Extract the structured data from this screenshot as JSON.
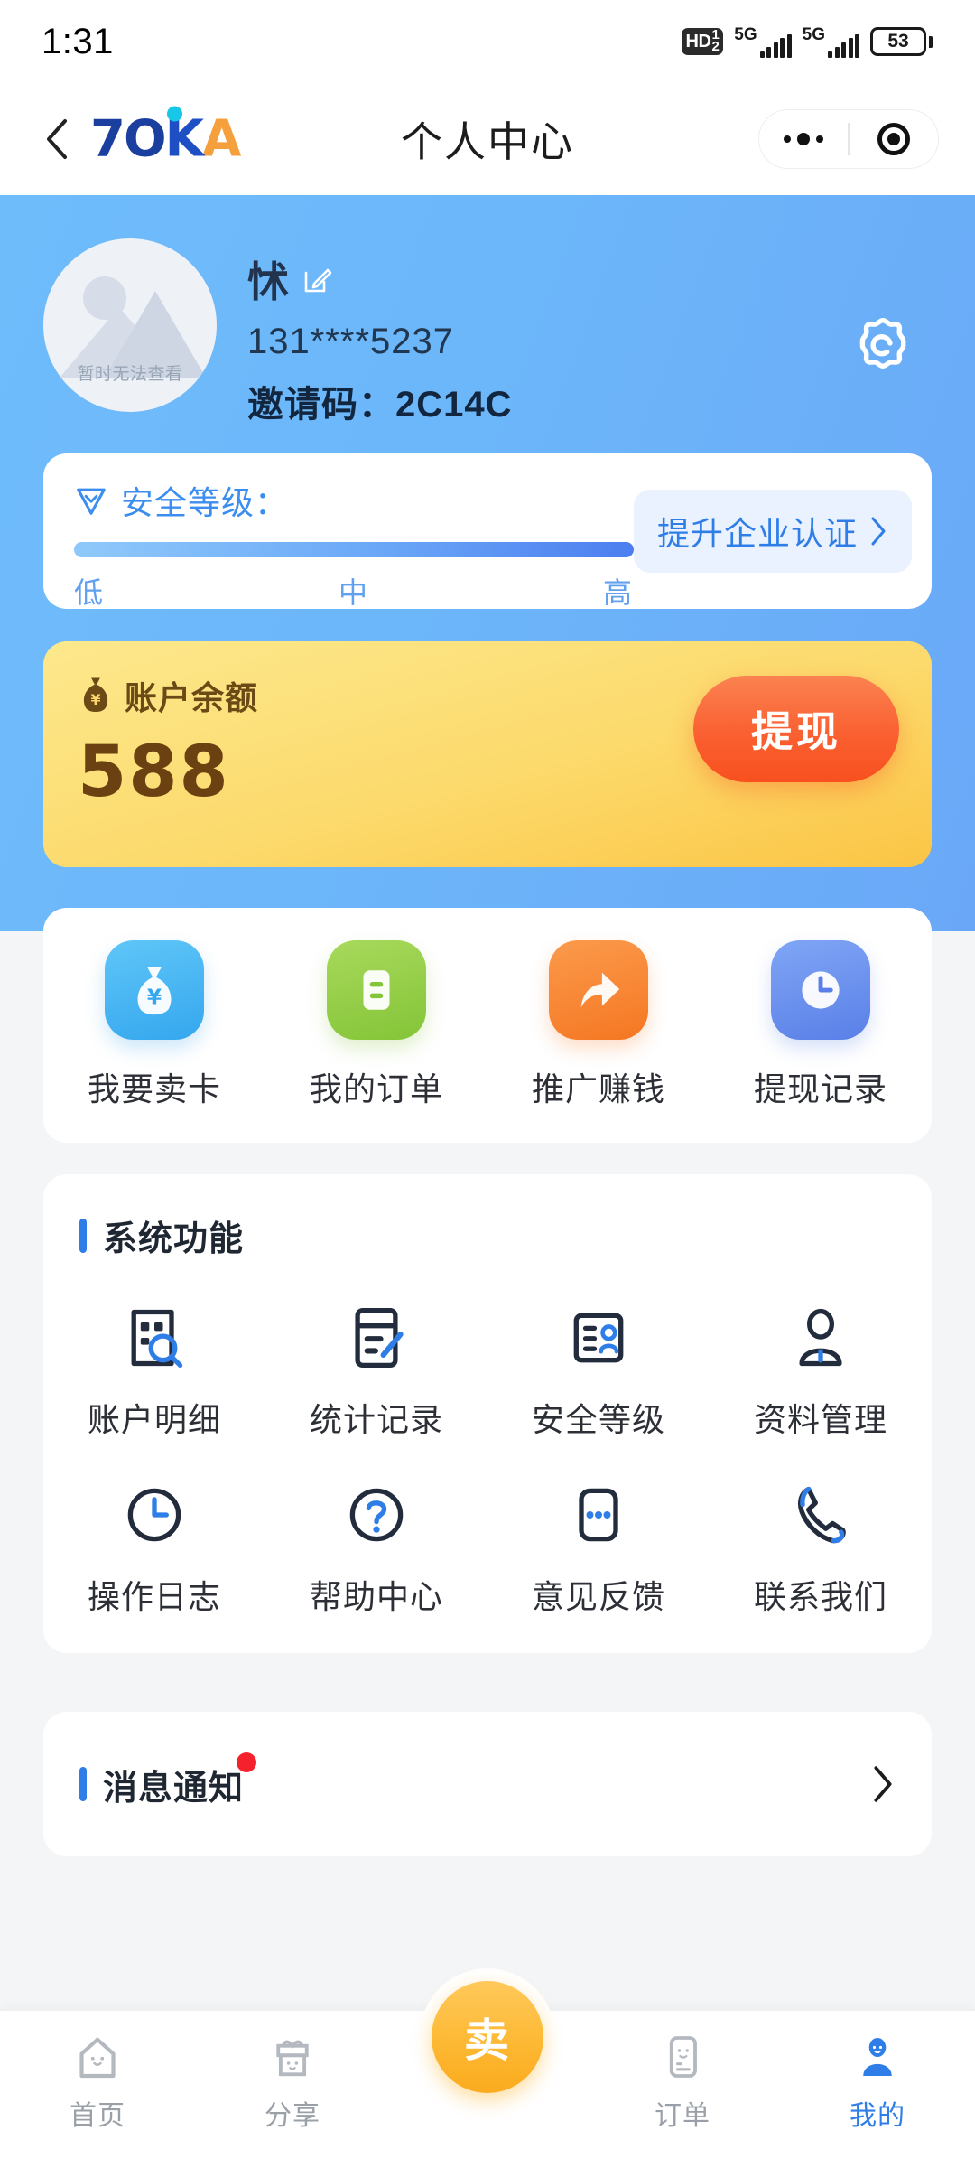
{
  "status_bar": {
    "time": "1:31",
    "hd_badge": "HD",
    "hd_sup": "1",
    "hd_sub": "2",
    "network_1": "5G",
    "network_2": "5G",
    "battery_percent": "53"
  },
  "nav": {
    "back_icon": "chevron-left-icon",
    "logo_blue": "7O",
    "logo_k": "K",
    "logo_orange": "A",
    "title": "个人中心",
    "capsule_menu_icon": "more-dots-icon",
    "capsule_close_icon": "target-circle-icon"
  },
  "profile": {
    "avatar_placeholder_text": "暂时无法查看",
    "name": "怵",
    "edit_icon": "edit-pencil-icon",
    "phone": "131****5237",
    "invite_code": "邀请码：2C14C",
    "settings_icon": "gear-icon"
  },
  "security": {
    "shield_icon": "shield-check-icon",
    "title": "安全等级：",
    "level_low": "低",
    "level_mid": "中",
    "level_high": "高",
    "cta_label": "提升企业认证",
    "cta_icon": "chevron-right-icon",
    "progress_percent": 100
  },
  "balance": {
    "bag_icon": "money-bag-icon",
    "label": "账户余额",
    "amount": "588",
    "withdraw_label": "提现"
  },
  "quick_actions": [
    {
      "label": "我要卖卡",
      "icon": "money-bag-icon",
      "color": "#35a7ef"
    },
    {
      "label": "我的订单",
      "icon": "order-list-icon",
      "color": "#84c438"
    },
    {
      "label": "推广赚钱",
      "icon": "share-arrow-icon",
      "color": "#f57722"
    },
    {
      "label": "提现记录",
      "icon": "clock-icon",
      "color": "#5a7fe8"
    }
  ],
  "system": {
    "heading": "系统功能",
    "items": [
      {
        "label": "账户明细",
        "icon": "document-search-icon"
      },
      {
        "label": "统计记录",
        "icon": "document-edit-icon"
      },
      {
        "label": "安全等级",
        "icon": "id-card-icon"
      },
      {
        "label": "资料管理",
        "icon": "user-profile-icon"
      },
      {
        "label": "操作日志",
        "icon": "clock-icon"
      },
      {
        "label": "帮助中心",
        "icon": "question-circle-icon"
      },
      {
        "label": "意见反馈",
        "icon": "feedback-dots-icon"
      },
      {
        "label": "联系我们",
        "icon": "phone-call-icon"
      }
    ]
  },
  "message": {
    "heading": "消息通知",
    "has_badge": true,
    "arrow_icon": "chevron-right-icon"
  },
  "tabbar": {
    "items": [
      {
        "label": "首页",
        "icon": "home-icon",
        "active": false
      },
      {
        "label": "分享",
        "icon": "gift-icon",
        "active": false
      },
      {
        "label": "订单",
        "icon": "receipt-icon",
        "active": false
      },
      {
        "label": "我的",
        "icon": "person-icon",
        "active": true
      }
    ],
    "fab_label": "卖"
  },
  "colors": {
    "header_blue": "#6cb6fa",
    "accent_blue": "#2f7ee8",
    "balance_yellow": "#fcd96a",
    "withdraw_orange": "#fa6031",
    "fab_yellow": "#fdb731",
    "badge_red": "#f5222d"
  }
}
